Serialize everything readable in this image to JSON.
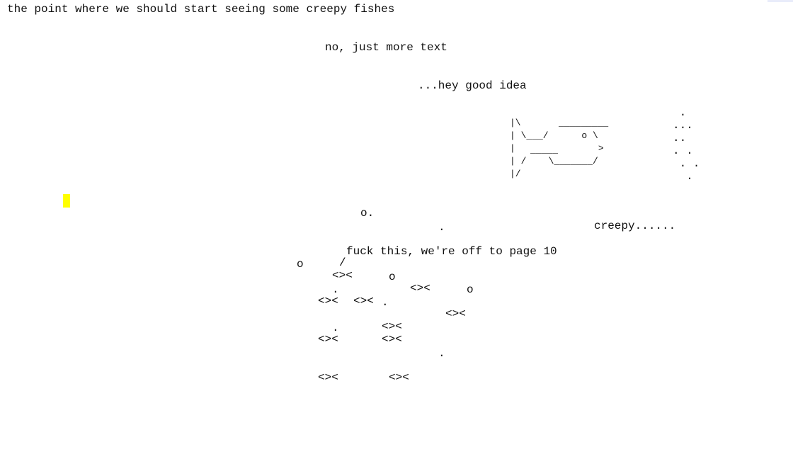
{
  "lines": {
    "l1": "the point where we should start seeing some creepy fishes",
    "l2": "no, just more text",
    "l3": "...hey good idea",
    "creepy": "creepy......",
    "off": "fuck this, we're off to page 10",
    "bubble_o_dot": "o.",
    "dot": "."
  },
  "big_fish": {
    "row1": "|\\                   ",
    "row2": "| \\___/      o \\     ",
    "row3": "|               >    ",
    "row4": "| /    \\_______/     ",
    "row5": "|/                   ",
    "top_line": "_________",
    "belly_line": "_____"
  },
  "side_dots": {
    "d1": " .",
    "d2": "...",
    "d3": "..",
    "d4": ". .",
    "d5": " . .",
    "d6": "  ."
  },
  "small_fish": {
    "fish": "<><",
    "bubble": "o",
    "dot": ".",
    "slash": "/"
  },
  "colors": {
    "cursor": "#ffff00",
    "text": "#111111",
    "corner_tab": "#e9ecfa"
  }
}
